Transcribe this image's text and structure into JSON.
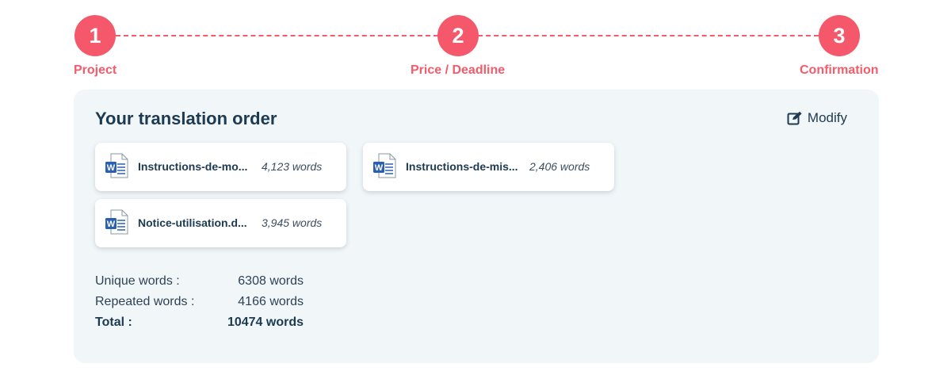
{
  "stepper": {
    "steps": [
      {
        "number": "1",
        "label": "Project"
      },
      {
        "number": "2",
        "label": "Price / Deadline"
      },
      {
        "number": "3",
        "label": "Confirmation"
      }
    ],
    "accent_color": "#f4586a"
  },
  "order": {
    "title": "Your translation order",
    "modify_label": "Modify",
    "files": [
      {
        "name": "Instructions-de-mo...",
        "words": "4,123 words",
        "icon": "word-document-icon"
      },
      {
        "name": "Instructions-de-mis...",
        "words": "2,406 words",
        "icon": "word-document-icon"
      },
      {
        "name": "Notice-utilisation.d...",
        "words": "3,945 words",
        "icon": "word-document-icon"
      }
    ],
    "summary": {
      "unique_label": "Unique words :",
      "unique_value": "6308 words",
      "repeated_label": "Repeated words :",
      "repeated_value": "4166 words",
      "total_label": "Total :",
      "total_value": "10474 words"
    }
  },
  "colors": {
    "panel_background": "#f1f6f9",
    "text_dark": "#1c3a52",
    "word_blue": "#2b5fb4"
  }
}
